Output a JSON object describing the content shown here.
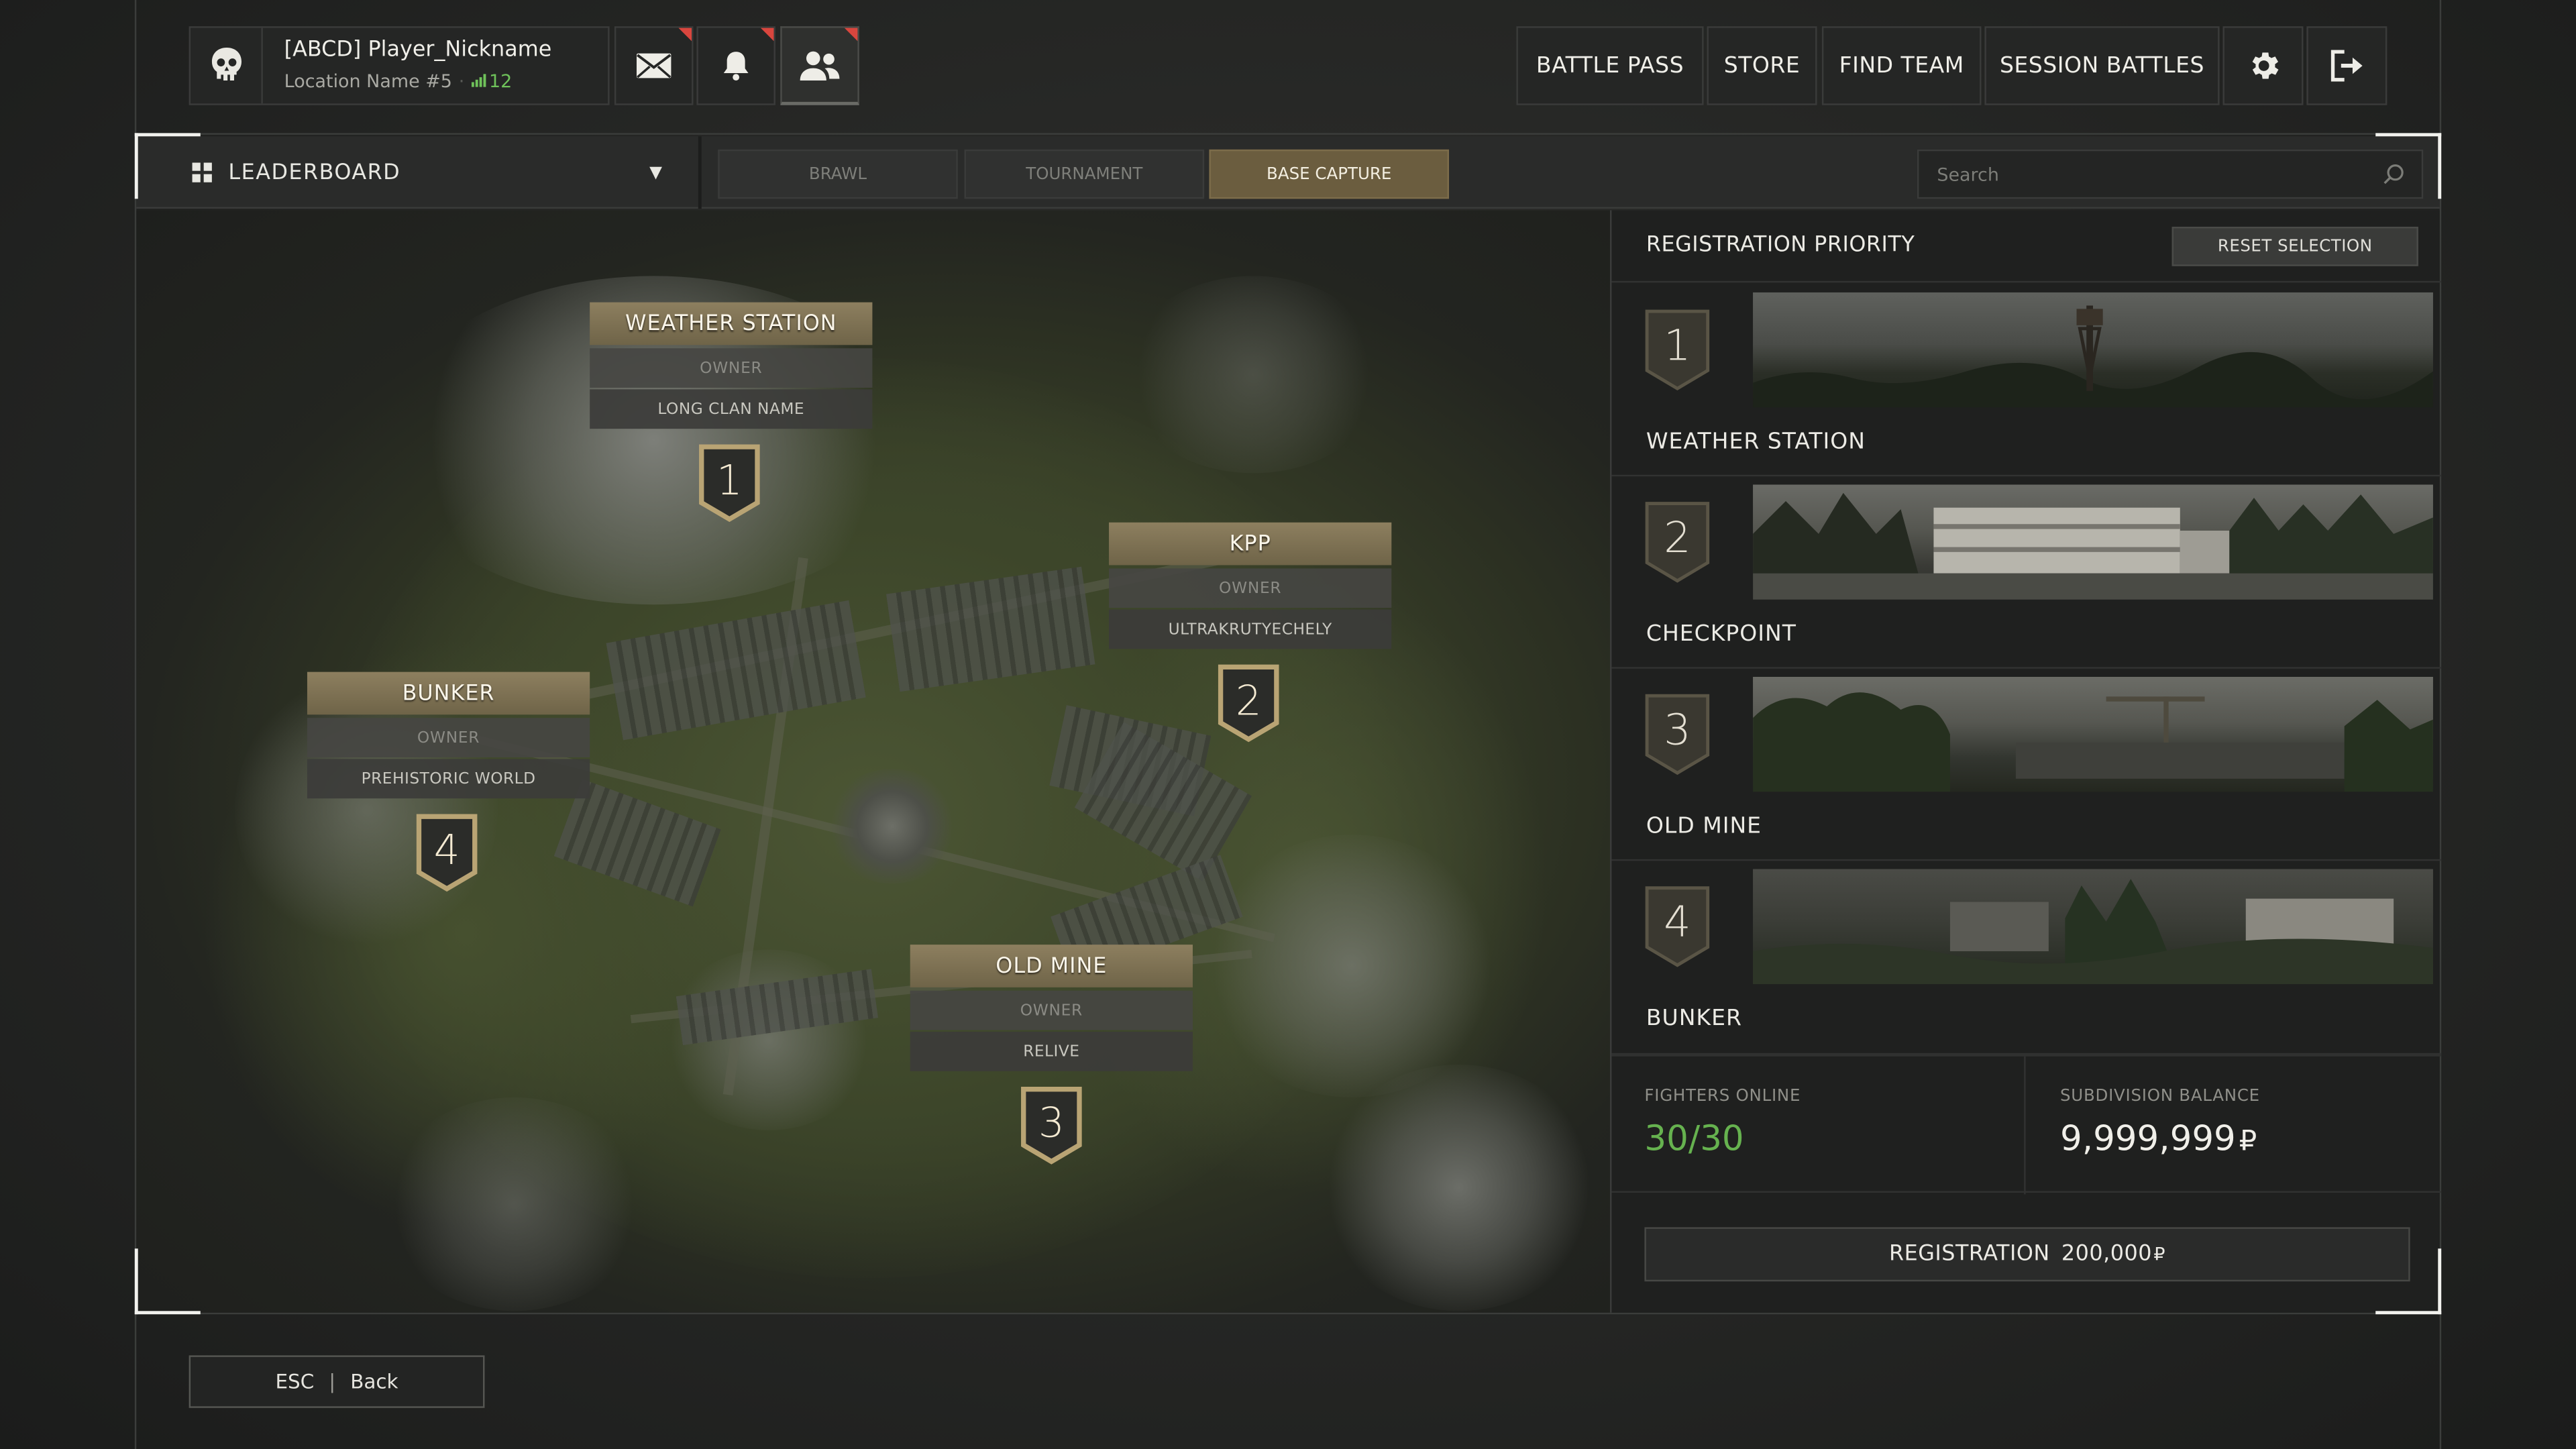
{
  "player": {
    "name": "[ABCD] Player_Nickname",
    "location": "Location Name #5",
    "ping": "12"
  },
  "nav": [
    "BATTLE PASS",
    "STORE",
    "FIND TEAM",
    "SESSION BATTLES"
  ],
  "leaderboard_label": "LEADERBOARD",
  "tabs": [
    "BRAWL",
    "TOURNAMENT",
    "BASE CAPTURE"
  ],
  "active_tab": "BASE CAPTURE",
  "search_placeholder": "Search",
  "map_locations": [
    {
      "name": "WEATHER STATION",
      "owner_label": "OWNER",
      "clan": "LONG CLAN NAME",
      "number": "1"
    },
    {
      "name": "KPP",
      "owner_label": "OWNER",
      "clan": "ULTRAKRUTYECHELY",
      "number": "2"
    },
    {
      "name": "BUNKER",
      "owner_label": "OWNER",
      "clan": "PREHISTORIC WORLD",
      "number": "4"
    },
    {
      "name": "OLD MINE",
      "owner_label": "OWNER",
      "clan": "RELIVE",
      "number": "3"
    }
  ],
  "panel": {
    "title": "REGISTRATION PRIORITY",
    "reset_label": "RESET SELECTION",
    "priorities": [
      {
        "number": "1",
        "name": "WEATHER STATION"
      },
      {
        "number": "2",
        "name": "CHECKPOINT"
      },
      {
        "number": "3",
        "name": "OLD MINE"
      },
      {
        "number": "4",
        "name": "BUNKER"
      }
    ],
    "fighters_label": "FIGHTERS ONLINE",
    "fighters_value": "30/30",
    "balance_label": "SUBDIVISION BALANCE",
    "balance_value": "9,999,999",
    "currency": "₽",
    "registration_label": "REGISTRATION",
    "registration_cost": "200,000"
  },
  "back": {
    "key": "ESC",
    "label": "Back"
  },
  "colors": {
    "accent_gold": "#8d7f5f",
    "active_tab": "#6b5d3f",
    "online_green": "#6fc25a",
    "notification_red": "#d9463e"
  },
  "icons": [
    "skull-icon",
    "mail-icon",
    "bell-icon",
    "friends-icon",
    "gear-icon",
    "exit-icon",
    "grid-icon",
    "search-icon",
    "dropdown-arrow-icon"
  ]
}
